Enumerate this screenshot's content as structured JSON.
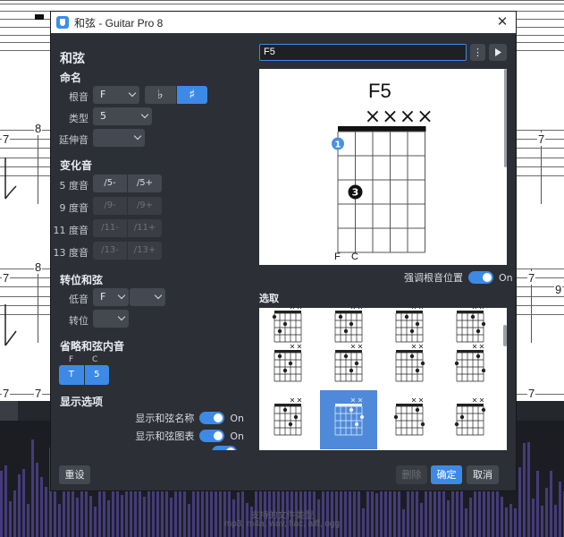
{
  "background": {
    "tab_numbers_row1": [
      "7",
      "8",
      "7",
      "7"
    ],
    "tab_numbers_row2": [
      "7",
      "8",
      "7",
      "7",
      "9"
    ],
    "tab_numbers_row3": [
      "7",
      "7",
      "7"
    ],
    "hint_line1": "支持的文件类型",
    "hint_line2": "mp3, m4a, wav, flac, aiff, ogg"
  },
  "dialog": {
    "title": "和弦 - Guitar Pro 8",
    "close_glyph": "✕",
    "heading": "和弦",
    "naming": {
      "heading": "命名",
      "root_label": "根音",
      "root_value": "F",
      "flat_glyph": "♭",
      "sharp_glyph": "♯",
      "type_label": "类型",
      "type_value": "5",
      "extension_label": "延伸音",
      "extension_value": ""
    },
    "alterations": {
      "heading": "变化音",
      "rows": [
        {
          "label": "5 度音",
          "opt1": "/5-",
          "opt2": "/5+",
          "enabled": true
        },
        {
          "label": "9 度音",
          "opt1": "/9-",
          "opt2": "/9+",
          "enabled": false
        },
        {
          "label": "11 度音",
          "opt1": "/11-",
          "opt2": "/11+",
          "enabled": false
        },
        {
          "label": "13 度音",
          "opt1": "/13-",
          "opt2": "/13+",
          "enabled": false
        }
      ]
    },
    "inversion": {
      "heading": "转位和弦",
      "bass_label": "低音",
      "bass_value": "F",
      "bass_value2": "",
      "inversion_label": "转位",
      "inversion_value": ""
    },
    "omissions": {
      "heading": "省略和弦内音",
      "notes": [
        "F",
        "C"
      ],
      "degrees": [
        "T",
        "5"
      ]
    },
    "display": {
      "heading": "显示选项",
      "options": [
        {
          "label": "显示和弦名称",
          "state": "On"
        },
        {
          "label": "显示和弦图表",
          "state": "On"
        }
      ]
    },
    "chord_input": "F5",
    "more_glyph": "⋮",
    "play_glyph": "▶",
    "diagram": {
      "name": "F5",
      "string_marks": [
        "",
        "",
        "×",
        "×",
        "×",
        "×"
      ],
      "fret_number": "1",
      "finger_on_string1": "1",
      "finger_on_string2": "3",
      "bottom_notes": [
        "F",
        "C"
      ]
    },
    "emphasize_root": {
      "label": "强调根音位置",
      "state": "On"
    },
    "gallery_heading": "选取",
    "buttons": {
      "reset": "重设",
      "delete": "删除",
      "ok": "确定",
      "cancel": "取消"
    }
  }
}
